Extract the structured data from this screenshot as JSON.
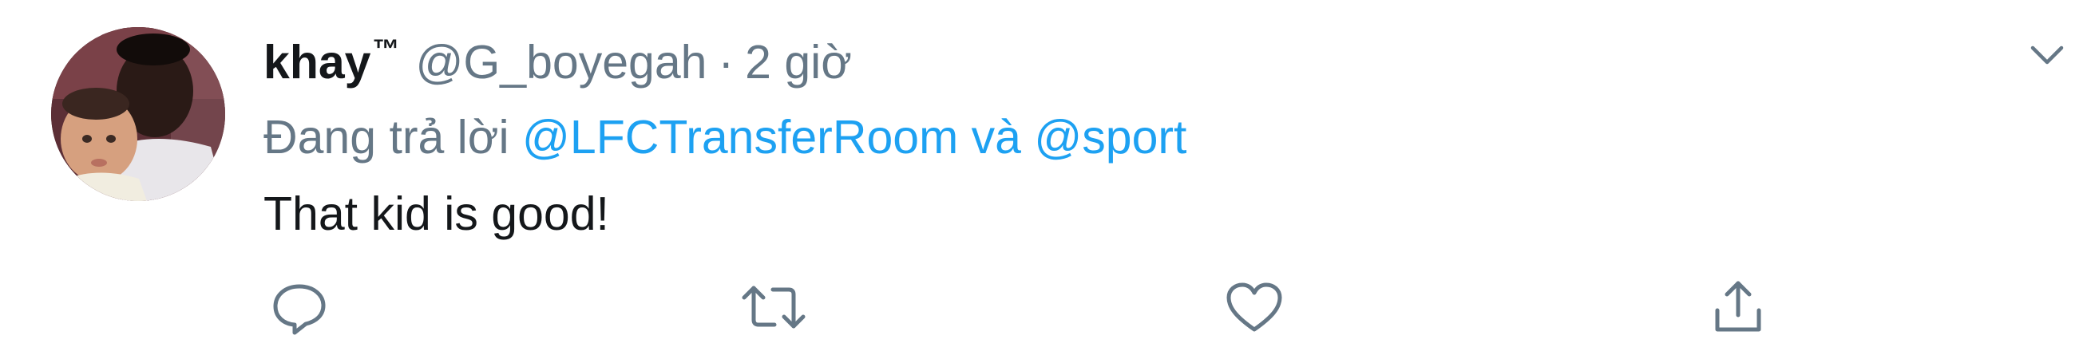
{
  "tweet": {
    "display_name": "khay",
    "badge": "™",
    "handle": "@G_boyegah",
    "separator": "·",
    "time": "2 giờ",
    "reply_prefix": "Đang trả lời",
    "reply_to_1": "@LFCTransferRoom",
    "reply_conjunction": "và",
    "reply_to_2": "@sport",
    "text": "That kid is good!"
  },
  "actions": {
    "reply_icon": "comment-icon",
    "retweet_icon": "retweet-icon",
    "like_icon": "heart-icon",
    "share_icon": "share-icon"
  },
  "menu": {
    "icon": "chevron-down-icon"
  },
  "colors": {
    "text": "#14171a",
    "secondary": "#657786",
    "link": "#1da1f2"
  }
}
